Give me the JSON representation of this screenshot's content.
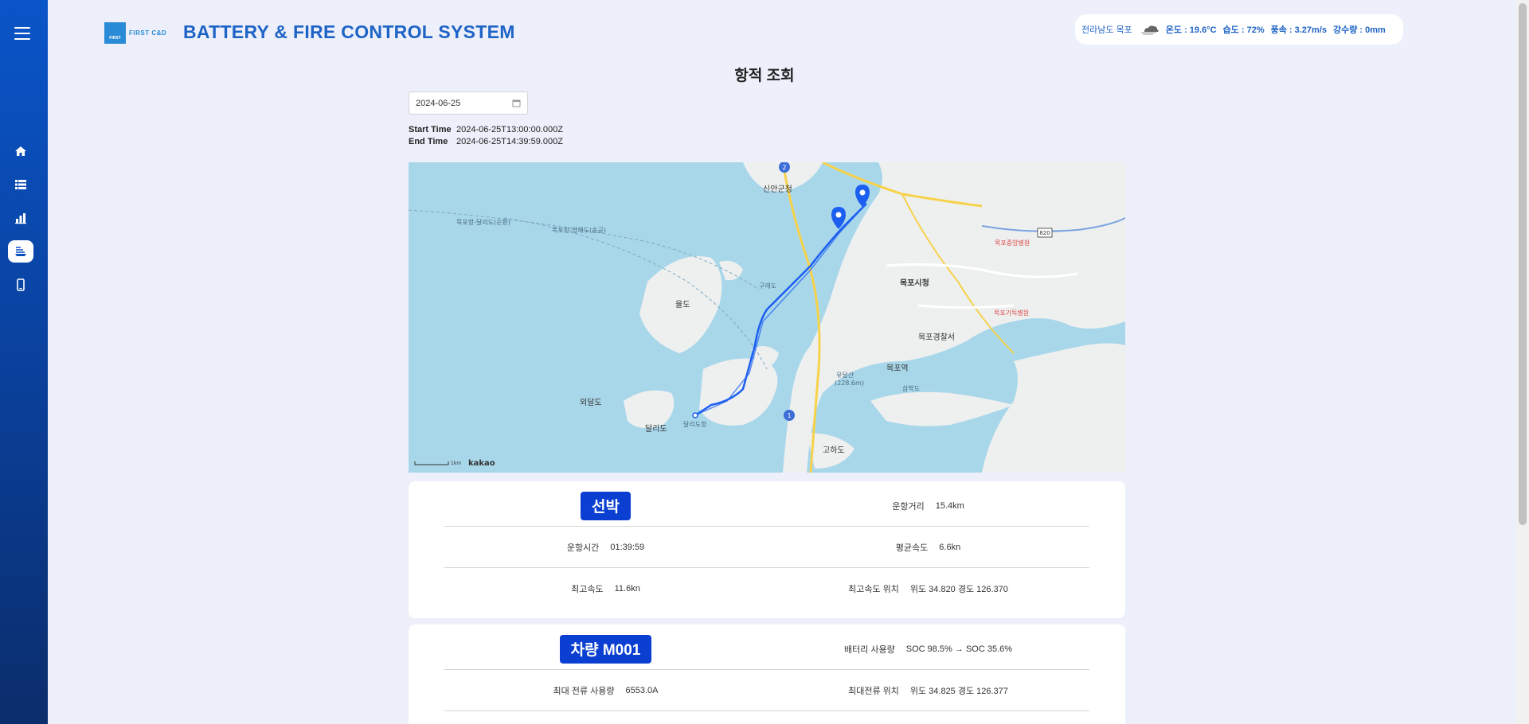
{
  "header": {
    "brand": "FIRST C&D",
    "brand_small": "FIRST",
    "title": "BATTERY & FIRE CONTROL SYSTEM"
  },
  "weather": {
    "location": "전라남도 목포",
    "temperature": "온도 : 19.6°C",
    "humidity": "습도 : 72%",
    "wind": "풍속 : 3.27m/s",
    "precipitation": "강수량 : 0mm",
    "icon": "cloud-wind-icon"
  },
  "page": {
    "title": "항적 조회",
    "date": "2024-06-25",
    "start_label": "Start Time",
    "start_value": "2024-06-25T13:00:00.000Z",
    "end_label": "End Time",
    "end_value": "2024-06-25T14:39:59.000Z"
  },
  "map": {
    "provider": "kakao",
    "scale": "1km",
    "route_color": "#1c5ff0",
    "labels": {
      "sinan": "신안군청",
      "mokpo_city": "목포시청",
      "mokpo_station": "목포역",
      "mokpo_police": "목포경찰서",
      "goha": "고하도",
      "oeda": "외달도",
      "dalri": "달리도",
      "yongdo": "율도",
      "yudalsan": "유달산",
      "yudalsan_height": "(228.6m)",
      "hospital1": "목포중앙병원",
      "hospital2": "목포기독병원",
      "gureung": "구레도",
      "samhak": "삼학도",
      "dalri_port": "달리도항",
      "route1": "목포항-달리도(순환)",
      "route2": "목포항-압해도(송공)",
      "road_820": "820",
      "road_2": "2",
      "road_1": "1"
    }
  },
  "vessel_card": {
    "badge": "선박",
    "distance_label": "운항거리",
    "distance_value": "15.4km",
    "time_label": "운항시간",
    "time_value": "01:39:59",
    "avg_speed_label": "평균속도",
    "avg_speed_value": "6.6kn",
    "max_speed_label": "최고속도",
    "max_speed_value": "11.6kn",
    "max_speed_pos_label": "최고속도 위치",
    "max_speed_pos_value": "위도 34.820   경도 126.370"
  },
  "vehicle_card": {
    "badge": "차량 M001",
    "battery_label": "배터리 사용량",
    "battery_value": "SOC 98.5%   → SOC 35.6%",
    "max_current_label": "최대 전류 사용량",
    "max_current_value": "6553.0A",
    "max_current_pos_label": "최대전류 위치",
    "max_current_pos_value": "위도 34.825   경도 126.377"
  }
}
